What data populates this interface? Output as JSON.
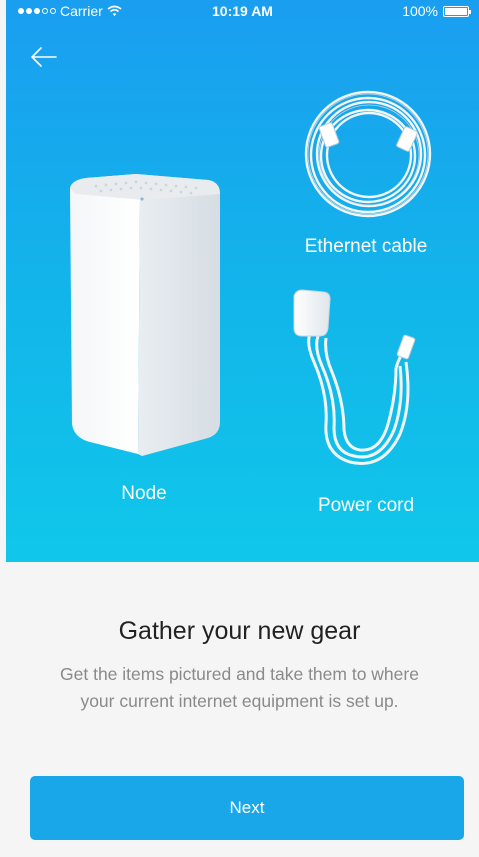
{
  "status_bar": {
    "carrier": "Carrier",
    "time": "10:19 AM",
    "battery": "100%"
  },
  "header": {
    "back_icon": "arrow-left-icon"
  },
  "illustrations": {
    "node_label": "Node",
    "ethernet_label": "Ethernet cable",
    "power_label": "Power cord"
  },
  "content": {
    "title": "Gather your new gear",
    "line1": "Get the items pictured and take them to where",
    "line2": "your current internet equipment is set up."
  },
  "actions": {
    "next_label": "Next"
  },
  "colors": {
    "hero_top": "#1a9ef0",
    "hero_bottom": "#10c7ea",
    "button": "#1aa7ea",
    "background": "#f5f5f5"
  }
}
